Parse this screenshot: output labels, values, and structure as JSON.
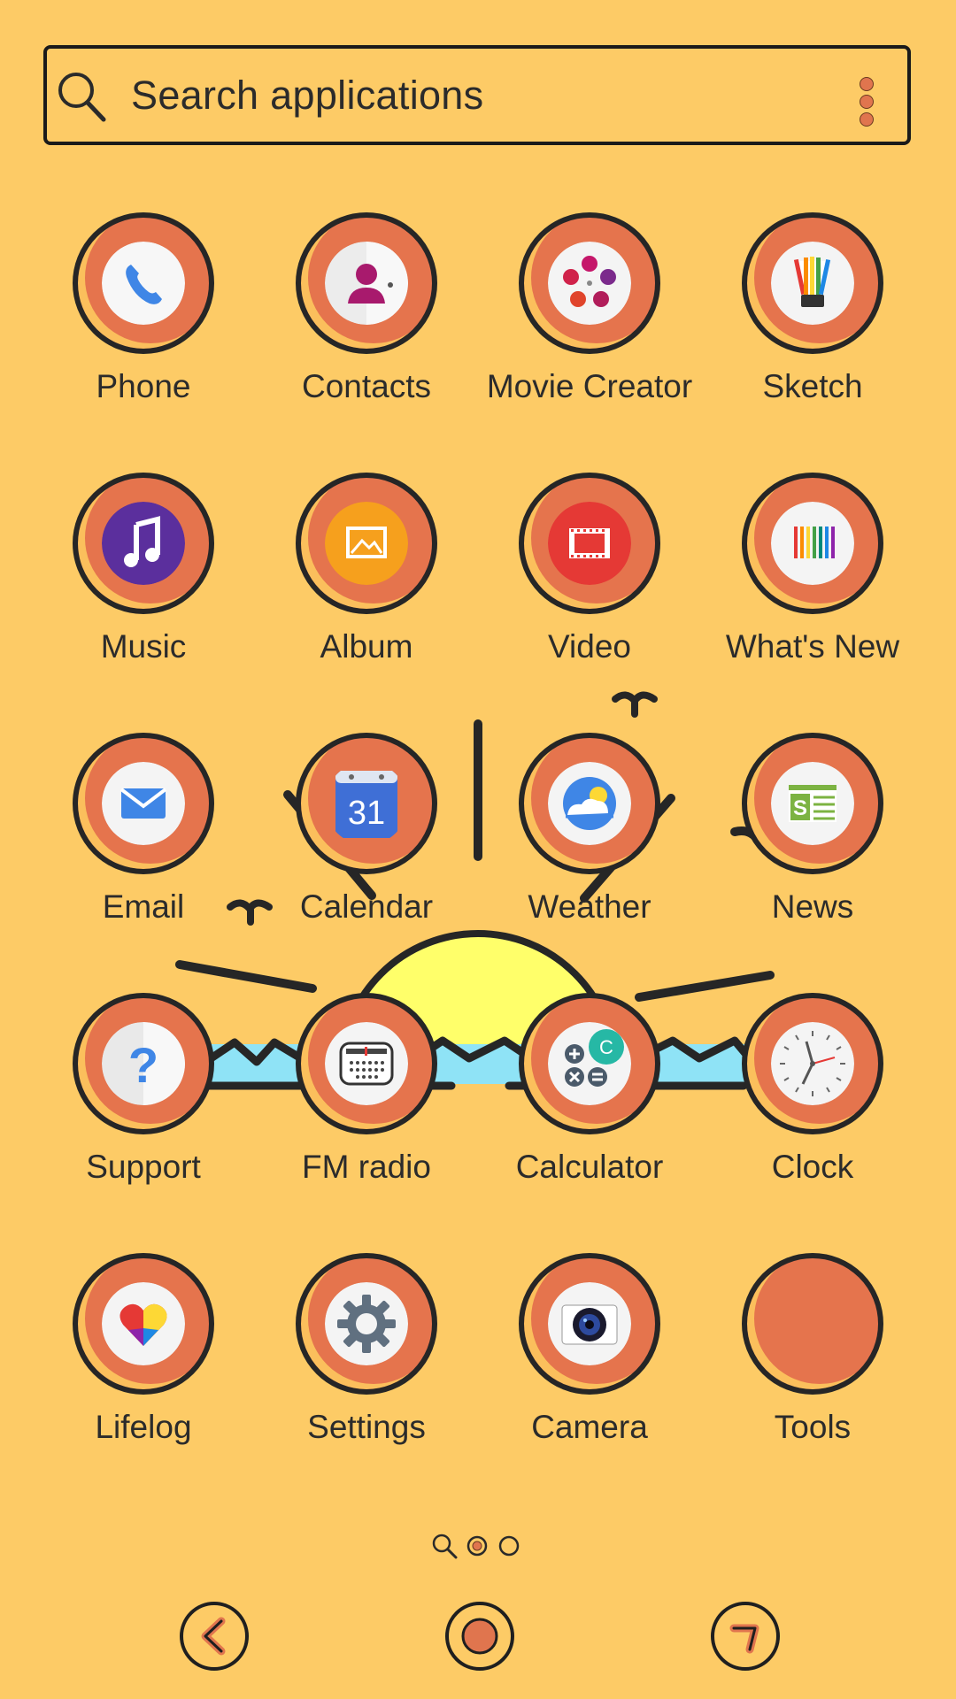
{
  "search": {
    "placeholder": "Search applications",
    "icon": "search-icon",
    "menu_icon": "more-vertical-icon"
  },
  "apps": [
    {
      "label": "Phone",
      "icon": "phone-icon"
    },
    {
      "label": "Contacts",
      "icon": "contacts-icon"
    },
    {
      "label": "Movie Creator",
      "icon": "movie-reel-icon"
    },
    {
      "label": "Sketch",
      "icon": "sketch-icon"
    },
    {
      "label": "Music",
      "icon": "music-note-icon"
    },
    {
      "label": "Album",
      "icon": "album-picture-icon"
    },
    {
      "label": "Video",
      "icon": "video-film-icon"
    },
    {
      "label": "What's New",
      "icon": "whats-new-icon"
    },
    {
      "label": "Email",
      "icon": "email-envelope-icon"
    },
    {
      "label": "Calendar",
      "icon": "calendar-icon",
      "badge": "31"
    },
    {
      "label": "Weather",
      "icon": "weather-icon"
    },
    {
      "label": "News",
      "icon": "news-icon",
      "badge": "S"
    },
    {
      "label": "Support",
      "icon": "support-question-icon",
      "badge": "?"
    },
    {
      "label": "FM radio",
      "icon": "fm-radio-icon"
    },
    {
      "label": "Calculator",
      "icon": "calculator-icon",
      "badge": "C"
    },
    {
      "label": "Clock",
      "icon": "clock-icon"
    },
    {
      "label": "Lifelog",
      "icon": "lifelog-heart-icon"
    },
    {
      "label": "Settings",
      "icon": "settings-gear-icon"
    },
    {
      "label": "Camera",
      "icon": "camera-icon"
    },
    {
      "label": "Tools",
      "icon": "tools-folder-icon"
    }
  ],
  "pages": {
    "count": 2,
    "current": 1,
    "search_page_icon": "search-page-icon"
  },
  "nav": [
    {
      "icon": "back-icon"
    },
    {
      "icon": "home-icon"
    },
    {
      "icon": "recents-icon"
    }
  ],
  "colors": {
    "background": "#fdcb66",
    "ring_fill": "#e5744d",
    "ring_stroke": "#262626",
    "sun": "#ffff6a",
    "water": "#8fe3f6",
    "accent_orange": "#e0754e"
  }
}
